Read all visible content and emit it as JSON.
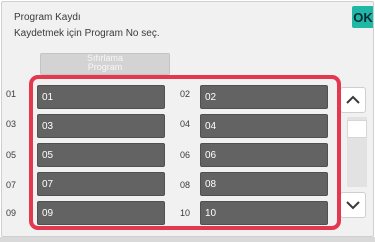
{
  "header": {
    "title": "Program Kaydı",
    "subtitle": "Kaydetmek için Program No seç.",
    "ok_label": "OK"
  },
  "reset_button": {
    "line1": "Sıfırlama",
    "line2": "Program"
  },
  "programs": [
    {
      "row_label": "01",
      "value": "01"
    },
    {
      "row_label": "02",
      "value": "02"
    },
    {
      "row_label": "03",
      "value": "03"
    },
    {
      "row_label": "04",
      "value": "04"
    },
    {
      "row_label": "05",
      "value": "05"
    },
    {
      "row_label": "06",
      "value": "06"
    },
    {
      "row_label": "07",
      "value": "07"
    },
    {
      "row_label": "08",
      "value": "08"
    },
    {
      "row_label": "09",
      "value": "09"
    },
    {
      "row_label": "10",
      "value": "10"
    }
  ],
  "scroll": {
    "up_icon": "chevron-up-icon",
    "down_icon": "chevron-down-icon"
  },
  "colors": {
    "accent_ok": "#1fb8a5",
    "highlight": "#e4384f",
    "program_button": "#636363"
  }
}
